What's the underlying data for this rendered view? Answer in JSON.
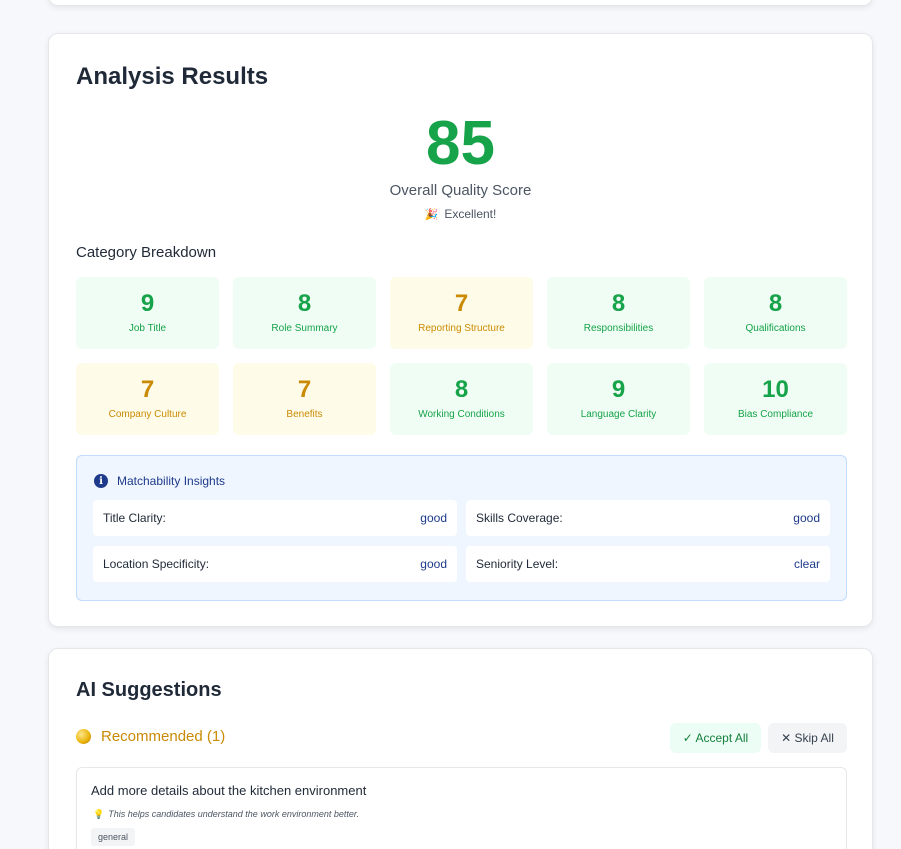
{
  "analysis": {
    "title": "Analysis Results",
    "score": "85",
    "score_label": "Overall Quality Score",
    "score_status": "Excellent!",
    "breakdown_title": "Category Breakdown",
    "categories": [
      {
        "score": "9",
        "label": "Job Title",
        "status": "good"
      },
      {
        "score": "8",
        "label": "Role Summary",
        "status": "good"
      },
      {
        "score": "7",
        "label": "Reporting Structure",
        "status": "mid"
      },
      {
        "score": "8",
        "label": "Responsibilities",
        "status": "good"
      },
      {
        "score": "8",
        "label": "Qualifications",
        "status": "good"
      },
      {
        "score": "7",
        "label": "Company Culture",
        "status": "mid"
      },
      {
        "score": "7",
        "label": "Benefits",
        "status": "mid"
      },
      {
        "score": "8",
        "label": "Working Conditions",
        "status": "good"
      },
      {
        "score": "9",
        "label": "Language Clarity",
        "status": "good"
      },
      {
        "score": "10",
        "label": "Bias Compliance",
        "status": "good"
      }
    ],
    "insights": {
      "title": "Matchability Insights",
      "rows": [
        {
          "key": "Title Clarity:",
          "value": "good"
        },
        {
          "key": "Skills Coverage:",
          "value": "good"
        },
        {
          "key": "Location Specificity:",
          "value": "good"
        },
        {
          "key": "Seniority Level:",
          "value": "clear"
        }
      ]
    }
  },
  "ai": {
    "title": "AI Suggestions",
    "recommended_label": "Recommended (1)",
    "accept_all": "✓ Accept All",
    "skip_all": "✕ Skip All",
    "suggestion": {
      "title": "Add more details about the kitchen environment",
      "note": "This helps candidates understand the work environment better.",
      "tag": "general"
    }
  },
  "colors": {
    "good": "#16a34a",
    "mid": "#ca8a04",
    "info": "#1e3a8a"
  }
}
